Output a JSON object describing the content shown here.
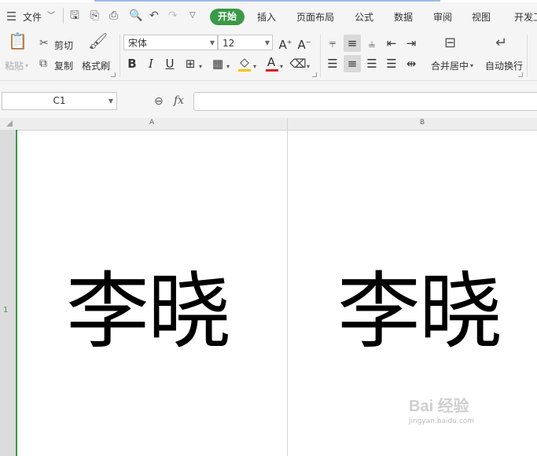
{
  "menu": {
    "file": "文件",
    "tabs": [
      "开始",
      "插入",
      "页面布局",
      "公式",
      "数据",
      "审阅",
      "视图",
      "开发工"
    ],
    "active_tab": "开始"
  },
  "ribbon": {
    "paste": "粘贴",
    "cut": "剪切",
    "copy": "复制",
    "format_painter": "格式刷",
    "font_name": "宋体",
    "font_size": "12",
    "bold": "B",
    "italic": "I",
    "underline": "U",
    "merge_center": "合并居中",
    "wrap_text": "自动换行"
  },
  "formula_bar": {
    "cell_ref": "C1",
    "fx": "fx",
    "content": ""
  },
  "sheet": {
    "columns": [
      "A",
      "B"
    ],
    "rows": [
      "1"
    ],
    "cells": [
      "李晓",
      "李晓"
    ]
  },
  "watermark": {
    "logo": "Bai 经验",
    "url": "jingyan.baidu.com"
  },
  "colors": {
    "accent": "#3a9a47",
    "font_color_bar": "#e02020",
    "fill_color_bar": "#f5c400"
  }
}
